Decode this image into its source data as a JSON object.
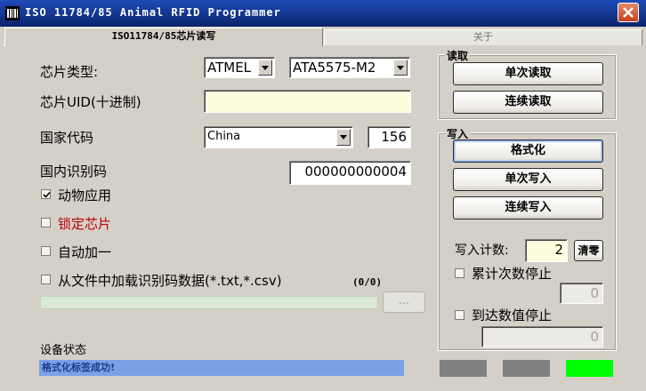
{
  "window": {
    "title": "ISO 11784/85 Animal RFID Programmer"
  },
  "tabs": [
    {
      "label": "ISO11784/85芯片读写"
    },
    {
      "label": "关于"
    }
  ],
  "form": {
    "chip_type": {
      "label": "芯片类型:",
      "vendor": "ATMEL",
      "model": "ATA5575-M2"
    },
    "chip_uid": {
      "label": "芯片UID(十进制)",
      "value": ""
    },
    "country_code": {
      "label": "国家代码",
      "country": "China",
      "code": "156"
    },
    "national_id": {
      "label": "国内识别码",
      "value": "000000000004"
    },
    "checkboxes": [
      {
        "label": "动物应用",
        "checked": true
      },
      {
        "label": "锁定芯片",
        "checked": false,
        "color": "#c00000"
      },
      {
        "label": "自动加一",
        "checked": false
      },
      {
        "label": "从文件中加载识别码数据(*.txt,*.csv)",
        "checked": false
      }
    ],
    "file_progress": "(0/0)",
    "browse_label": "...",
    "device_status": {
      "label": "设备状态",
      "message": "格式化标签成功!"
    }
  },
  "read_group": {
    "title": "读取",
    "single_read": "单次读取",
    "continuous_read": "连续读取"
  },
  "write_group": {
    "title": "写入",
    "format": "格式化",
    "single_write": "单次写入",
    "continuous_write": "连续写入",
    "write_count_label": "写入计数:",
    "write_count": "2",
    "clear_label": "清零",
    "stop_cumulative": {
      "label": "累计次数停止",
      "checked": false,
      "value": "0"
    },
    "stop_at_value": {
      "label": "到达数值停止",
      "checked": false,
      "value": "0"
    }
  },
  "indicators": [
    {
      "color": "#808080"
    },
    {
      "color": "#808080"
    },
    {
      "color": "#00ff00"
    }
  ]
}
